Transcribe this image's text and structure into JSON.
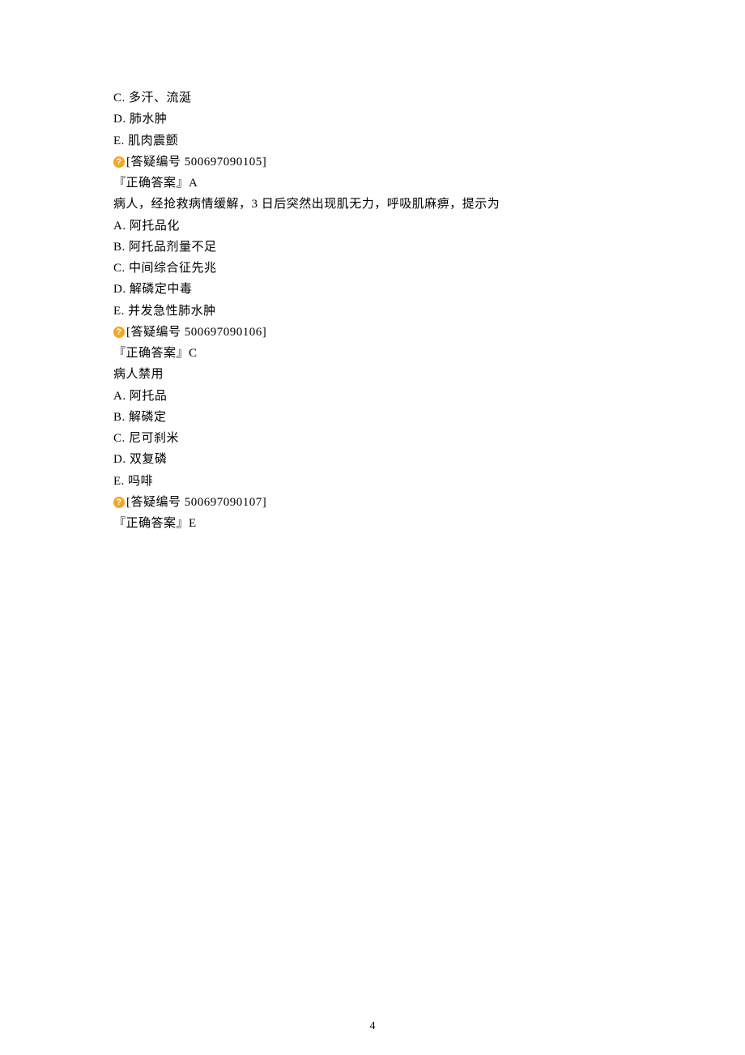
{
  "bullet_glyph": "?",
  "q1": {
    "options": {
      "c": "C. 多汗、流涎",
      "d": "D. 肺水肿",
      "e": "E. 肌肉震颤"
    },
    "ref_label": "[答疑编号 500697090105]",
    "answer_label": "『正确答案』A"
  },
  "q2": {
    "stem": "病人，经抢救病情缓解，3 日后突然出现肌无力，呼吸肌麻痹，提示为",
    "options": {
      "a": "A. 阿托品化",
      "b": "B. 阿托品剂量不足",
      "c": "C. 中间综合征先兆",
      "d": "D. 解磷定中毒",
      "e": "E. 并发急性肺水肿"
    },
    "ref_label": "[答疑编号 500697090106]",
    "answer_label": "『正确答案』C"
  },
  "q3": {
    "stem": "病人禁用",
    "options": {
      "a": "A. 阿托品",
      "b": "B. 解磷定",
      "c": "C. 尼可刹米",
      "d": "D. 双复磷",
      "e": "E. 吗啡"
    },
    "ref_label": "[答疑编号 500697090107]",
    "answer_label": "『正确答案』E"
  },
  "page_number": "4"
}
